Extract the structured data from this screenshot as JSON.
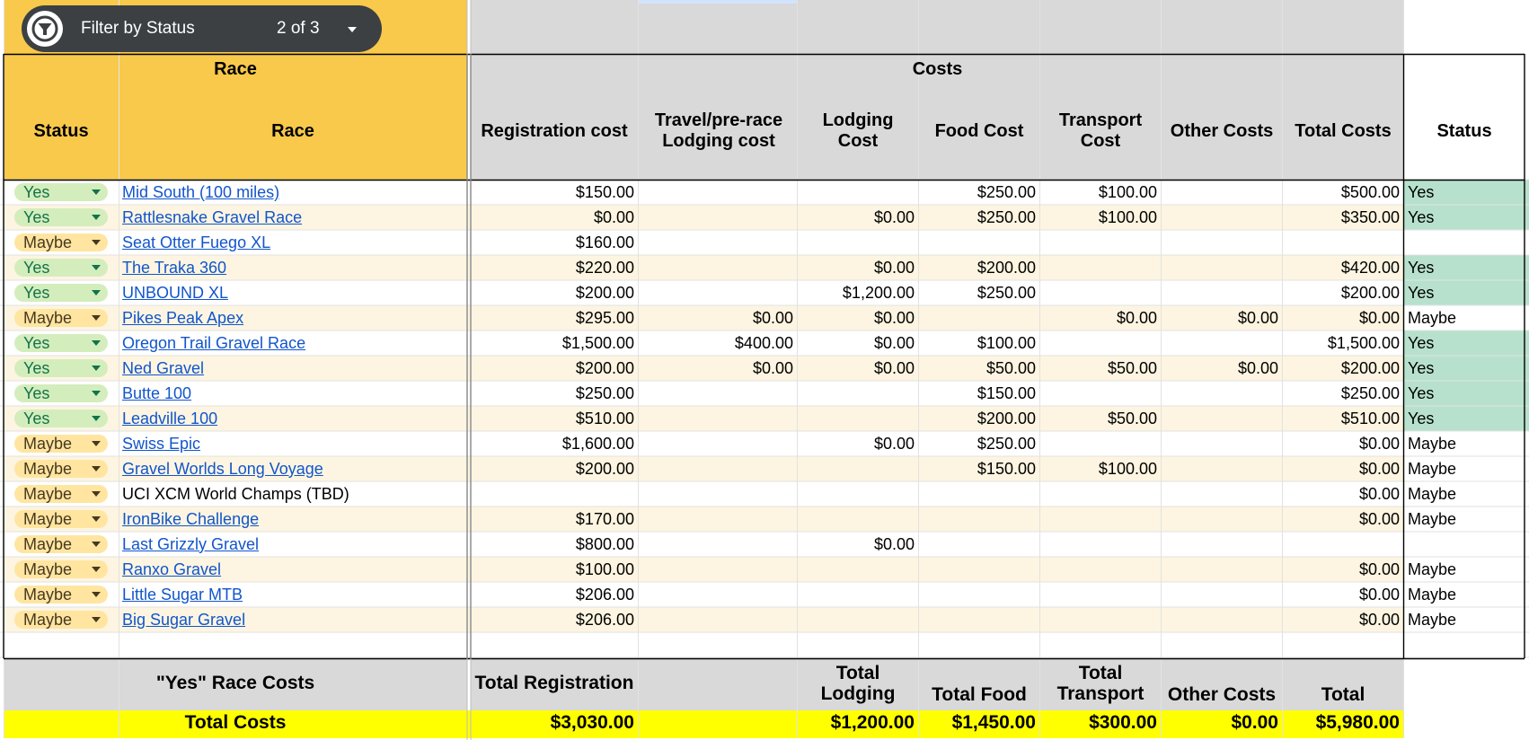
{
  "colors": {
    "race_header_bg": "#f8c94a",
    "costs_header_bg": "#d9d9d9",
    "row_band": "#fdf5e1",
    "yes_status_bg": "#b7e1cd",
    "total_row_bg": "#ffff00",
    "filter_bar_bg": "#3c4043",
    "link": "#1155cc"
  },
  "filter": {
    "icon": "filter-funnel-icon",
    "label": "Filter by Status",
    "count": "2 of 3"
  },
  "headers": {
    "race_group": "Race",
    "costs_group": "Costs",
    "status": "Status",
    "race": "Race",
    "registration": "Registration cost",
    "travel": "Travel/pre-race Lodging cost",
    "lodging": "Lodging Cost",
    "food": "Food Cost",
    "transport": "Transport Cost",
    "other": "Other Costs",
    "total": "Total Costs",
    "status_right": "Status"
  },
  "rows": [
    {
      "status": "Yes",
      "race": "Mid South (100 miles)",
      "link": true,
      "reg": "$150.00",
      "travel": "",
      "lodging": "",
      "food": "$250.00",
      "transport": "$100.00",
      "other": "",
      "total": "$500.00",
      "status2": "Yes"
    },
    {
      "status": "Yes",
      "race": "Rattlesnake Gravel Race",
      "link": true,
      "reg": "$0.00",
      "travel": "",
      "lodging": "$0.00",
      "food": "$250.00",
      "transport": "$100.00",
      "other": "",
      "total": "$350.00",
      "status2": "Yes"
    },
    {
      "status": "Maybe",
      "race": "Seat Otter Fuego XL",
      "link": true,
      "reg": "$160.00",
      "travel": "",
      "lodging": "",
      "food": "",
      "transport": "",
      "other": "",
      "total": "",
      "status2": ""
    },
    {
      "status": "Yes",
      "race": "The Traka 360",
      "link": true,
      "reg": "$220.00",
      "travel": "",
      "lodging": "$0.00",
      "food": "$200.00",
      "transport": "",
      "other": "",
      "total": "$420.00",
      "status2": "Yes"
    },
    {
      "status": "Yes",
      "race": "UNBOUND XL",
      "link": true,
      "reg": "$200.00",
      "travel": "",
      "lodging": "$1,200.00",
      "food": "$250.00",
      "transport": "",
      "other": "",
      "total": "$200.00",
      "status2": "Yes"
    },
    {
      "status": "Maybe",
      "race": "Pikes Peak Apex",
      "link": true,
      "reg": "$295.00",
      "travel": "$0.00",
      "lodging": "$0.00",
      "food": "",
      "transport": "$0.00",
      "other": "$0.00",
      "total": "$0.00",
      "status2": "Maybe"
    },
    {
      "status": "Yes",
      "race": "Oregon Trail Gravel Race",
      "link": true,
      "reg": "$1,500.00",
      "travel": "$400.00",
      "lodging": "$0.00",
      "food": "$100.00",
      "transport": "",
      "other": "",
      "total": "$1,500.00",
      "status2": "Yes"
    },
    {
      "status": "Yes",
      "race": "Ned Gravel",
      "link": true,
      "reg": "$200.00",
      "travel": "$0.00",
      "lodging": "$0.00",
      "food": "$50.00",
      "transport": "$50.00",
      "other": "$0.00",
      "total": "$200.00",
      "status2": "Yes"
    },
    {
      "status": "Yes",
      "race": "Butte 100",
      "link": true,
      "reg": "$250.00",
      "travel": "",
      "lodging": "",
      "food": "$150.00",
      "transport": "",
      "other": "",
      "total": "$250.00",
      "status2": "Yes"
    },
    {
      "status": "Yes",
      "race": "Leadville 100",
      "link": true,
      "reg": "$510.00",
      "travel": "",
      "lodging": "",
      "food": "$200.00",
      "transport": "$50.00",
      "other": "",
      "total": "$510.00",
      "status2": "Yes"
    },
    {
      "status": "Maybe",
      "race": "Swiss Epic",
      "link": true,
      "reg": "$1,600.00",
      "travel": "",
      "lodging": "$0.00",
      "food": "$250.00",
      "transport": "",
      "other": "",
      "total": "$0.00",
      "status2": "Maybe"
    },
    {
      "status": "Maybe",
      "race": "Gravel Worlds Long Voyage",
      "link": true,
      "reg": "$200.00",
      "travel": "",
      "lodging": "",
      "food": "$150.00",
      "transport": "$100.00",
      "other": "",
      "total": "$0.00",
      "status2": "Maybe"
    },
    {
      "status": "Maybe",
      "race": "UCI XCM World Champs (TBD)",
      "link": false,
      "reg": "",
      "travel": "",
      "lodging": "",
      "food": "",
      "transport": "",
      "other": "",
      "total": "$0.00",
      "status2": "Maybe"
    },
    {
      "status": "Maybe",
      "race": "IronBike Challenge",
      "link": true,
      "reg": "$170.00",
      "travel": "",
      "lodging": "",
      "food": "",
      "transport": "",
      "other": "",
      "total": "$0.00",
      "status2": "Maybe"
    },
    {
      "status": "Maybe",
      "race": "Last Grizzly Gravel",
      "link": true,
      "reg": "$800.00",
      "travel": "",
      "lodging": "$0.00",
      "food": "",
      "transport": "",
      "other": "",
      "total": "",
      "status2": ""
    },
    {
      "status": "Maybe",
      "race": "Ranxo Gravel",
      "link": true,
      "reg": "$100.00",
      "travel": "",
      "lodging": "",
      "food": "",
      "transport": "",
      "other": "",
      "total": "$0.00",
      "status2": "Maybe"
    },
    {
      "status": "Maybe",
      "race": "Little Sugar MTB",
      "link": true,
      "reg": "$206.00",
      "travel": "",
      "lodging": "",
      "food": "",
      "transport": "",
      "other": "",
      "total": "$0.00",
      "status2": "Maybe"
    },
    {
      "status": "Maybe",
      "race": "Big Sugar Gravel",
      "link": true,
      "reg": "$206.00",
      "travel": "",
      "lodging": "",
      "food": "",
      "transport": "",
      "other": "",
      "total": "$0.00",
      "status2": "Maybe"
    }
  ],
  "footer": {
    "yes_label": "\"Yes\" Race Costs",
    "total_registration": "Total Registration",
    "total_lodging": "Total Lodging",
    "total_food": "Total Food",
    "total_transport": "Total Transport",
    "other_costs": "Other Costs",
    "total": "Total",
    "total_costs_label": "Total Costs",
    "values": {
      "registration": "$3,030.00",
      "lodging": "$1,200.00",
      "food": "$1,450.00",
      "transport": "$300.00",
      "other": "$0.00",
      "total": "$5,980.00"
    }
  }
}
